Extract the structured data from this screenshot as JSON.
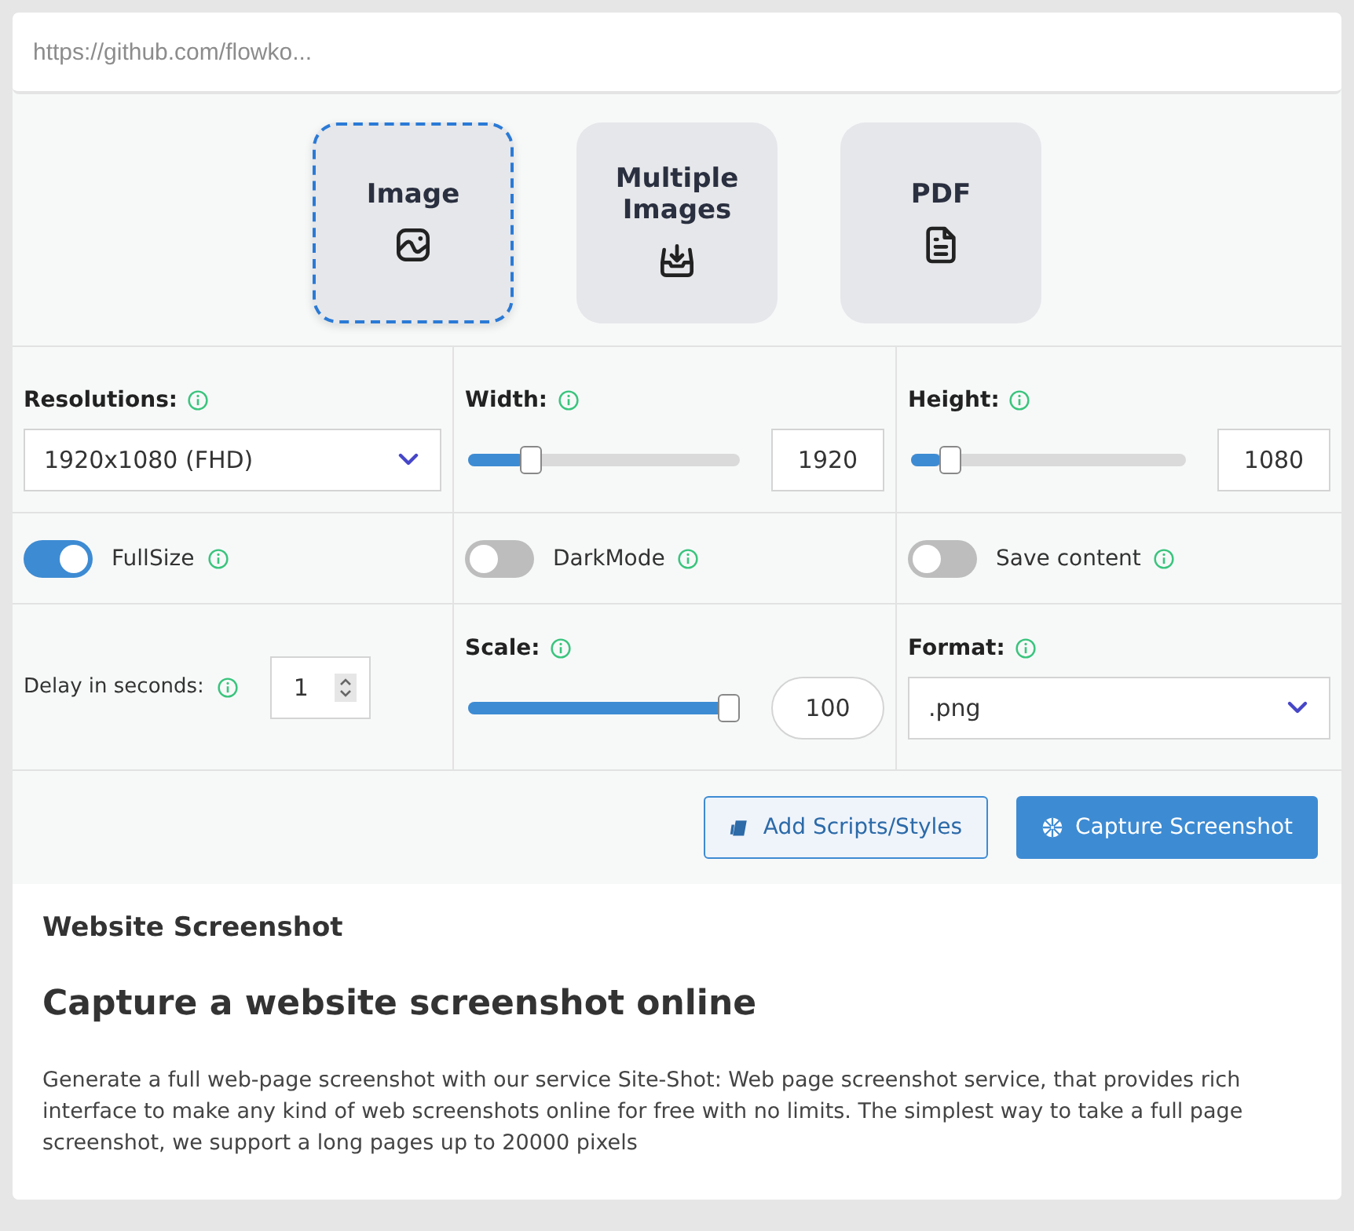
{
  "url_field": {
    "placeholder": "https://github.com/flowko..."
  },
  "modes": [
    {
      "label": "Image",
      "kind": "image",
      "selected": true
    },
    {
      "label": "Multiple Images",
      "kind": "inbox",
      "selected": false
    },
    {
      "label": "PDF",
      "kind": "file",
      "selected": false
    }
  ],
  "settings": [
    {
      "kind": "select",
      "label": "Resolutions:",
      "value": "1920x1080 (FHD)"
    },
    {
      "kind": "slider",
      "label": "Width:",
      "level": 0.21,
      "value": "1920",
      "rounded": false
    },
    {
      "kind": "slider",
      "label": "Height:",
      "level": 0.11,
      "value": "1080",
      "rounded": false
    },
    {
      "kind": "toggle",
      "label": "FullSize",
      "on": true
    },
    {
      "kind": "toggle",
      "label": "DarkMode",
      "on": false
    },
    {
      "kind": "toggle",
      "label": "Save content",
      "on": false
    },
    {
      "kind": "spinner",
      "label": "Delay in seconds:",
      "value": "1"
    },
    {
      "kind": "slider",
      "label": "Scale:",
      "level": 1,
      "value": "100",
      "rounded": true
    },
    {
      "kind": "select",
      "label": "Format:",
      "value": ".png"
    }
  ],
  "buttons": [
    {
      "kind": "outline",
      "label": "Add Scripts/Styles"
    },
    {
      "kind": "primary",
      "label": "Capture Screenshot"
    }
  ],
  "article": {
    "heading": "Website Screenshot",
    "title": "Capture a website screenshot online",
    "body": "Generate a full web-page screenshot with our service Site-Shot: Web page screenshot service, that provides rich interface to make any kind of web screenshots online for free with no limits. The simplest way to take a full page screenshot, we support a long pages up to 20000 pixels"
  }
}
